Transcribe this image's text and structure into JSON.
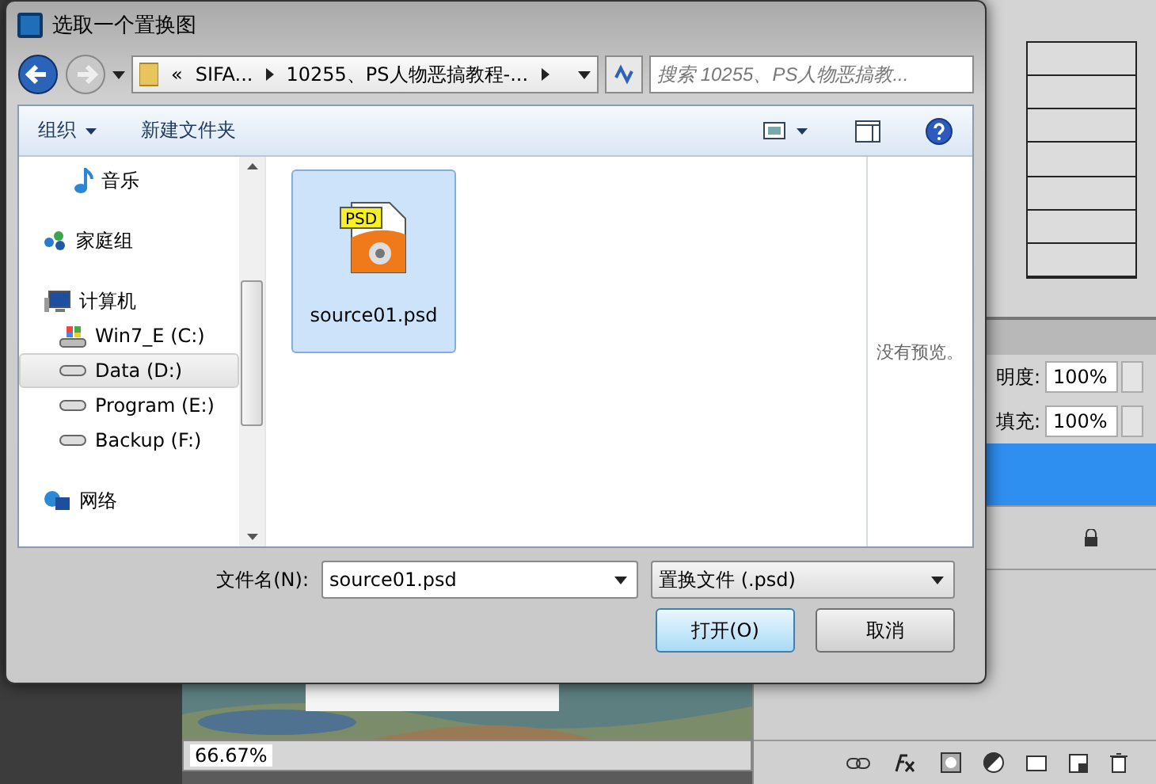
{
  "dialog": {
    "title": "选取一个置换图",
    "nav": {
      "breadcrumb": [
        "«",
        "SIFA...",
        "10255、PS人物恶搞教程-..."
      ],
      "search": {
        "placeholder": "搜索 10255、PS人物恶搞教..."
      }
    },
    "toolbar": {
      "organize": "组织",
      "new_folder": "新建文件夹"
    },
    "sidebar": [
      {
        "label": "音乐",
        "kind": "music",
        "selected": false
      },
      {
        "label": "家庭组",
        "kind": "homegroup",
        "selected": false
      },
      {
        "label": "计算机",
        "kind": "computer",
        "selected": false,
        "children": [
          {
            "label": "Win7_E (C:)",
            "kind": "system_drive",
            "selected": false
          },
          {
            "label": "Data (D:)",
            "kind": "drive",
            "selected": true
          },
          {
            "label": "Program (E:)",
            "kind": "drive",
            "selected": false
          },
          {
            "label": "Backup (F:)",
            "kind": "drive",
            "selected": false
          }
        ]
      },
      {
        "label": "网络",
        "kind": "network",
        "selected": false
      }
    ],
    "files": [
      {
        "name": "source01.psd",
        "badge": "PSD",
        "selected": true
      }
    ],
    "preview": "没有预览。",
    "filename": {
      "label": "文件名(N):",
      "value": "source01.psd"
    },
    "filetype": "置换文件 (.psd)",
    "buttons": [
      {
        "label": "打开(O)",
        "kind": "primary"
      },
      {
        "label": "取消",
        "kind": "default"
      }
    ]
  },
  "photoshop": {
    "zoom": "66.67%",
    "layers": {
      "opacity": {
        "label": "明度:",
        "value": "100%"
      },
      "fill": {
        "label": "填充:",
        "value": "100%"
      },
      "rows": [
        {
          "selected": true,
          "locked": false
        },
        {
          "selected": false,
          "locked": true
        }
      ]
    }
  }
}
